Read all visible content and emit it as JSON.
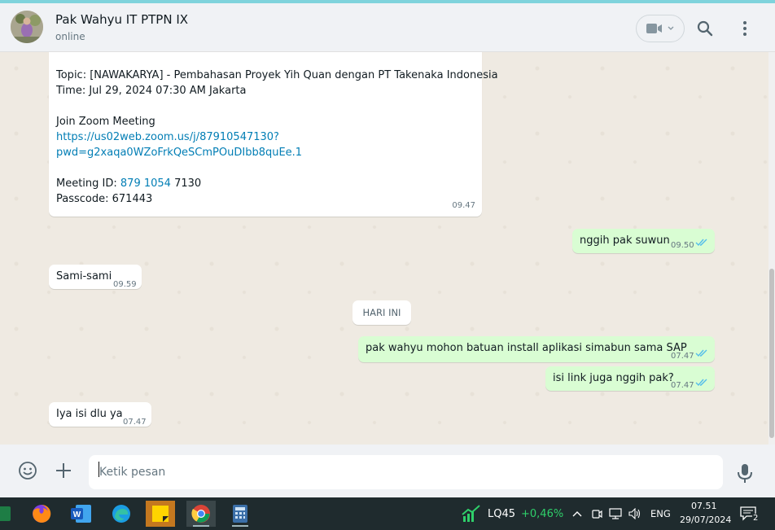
{
  "header": {
    "contact_name": "Pak Wahyu IT PTPN IX",
    "status": "online",
    "icons": [
      "video-call-icon",
      "search-icon",
      "more-options-icon"
    ]
  },
  "messages": {
    "big": {
      "cut_line": "",
      "topic": "Topic: [NAWAKARYA] - Pembahasan Proyek Yih Quan dengan PT Takenaka Indonesia",
      "time_line": "Time: Jul 29, 2024 07:30 AM Jakarta",
      "join": "Join Zoom Meeting",
      "link1": "https://us02web.zoom.us/j/87910547130?",
      "link2": "pwd=g2xaqa0WZoFrkQeSCmPOuDIbb8quEe.1",
      "meeting_id_label": "Meeting ID: ",
      "meeting_id_link": "879 1054",
      "meeting_id_rest": " 7130",
      "passcode": "Passcode: 671443",
      "timestamp": "09.47"
    },
    "m1": {
      "text": "nggih pak suwun",
      "time": "09.50"
    },
    "m2": {
      "text": "Sami-sami",
      "time": "09.59"
    },
    "date_chip": "HARI INI",
    "m3": {
      "text": "pak wahyu mohon batuan install aplikasi simabun sama SAP",
      "time": "07.47"
    },
    "m4": {
      "text": "isi link juga nggih pak?",
      "time": "07.47"
    },
    "m5": {
      "text": "Iya isi dlu ya",
      "time": "07.47"
    }
  },
  "input": {
    "placeholder": "Ketik pesan"
  },
  "taskbar": {
    "stock_name": "LQ45",
    "stock_change": "+0,46%",
    "language": "ENG",
    "clock_time": "07.51",
    "clock_date": "29/07/2024",
    "notification_count": "2"
  },
  "colors": {
    "outgoing_bubble": "#d9fdd3",
    "incoming_bubble": "#ffffff",
    "read_ticks": "#53bdeb",
    "link": "#027eb5",
    "stock_up": "#2fcf6a"
  }
}
